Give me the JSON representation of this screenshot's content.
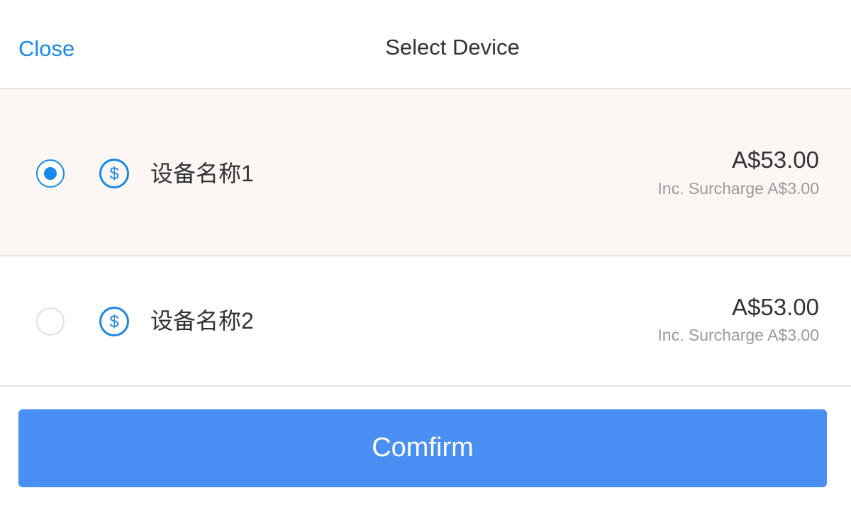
{
  "header": {
    "close_label": "Close",
    "title": "Select Device"
  },
  "devices": [
    {
      "name": "设备名称1",
      "price": "A$53.00",
      "surcharge": "Inc. Surcharge A$3.00",
      "selected": true,
      "icon": "dollar-circle-icon"
    },
    {
      "name": "设备名称2",
      "price": "A$53.00",
      "surcharge": "Inc. Surcharge A$3.00",
      "selected": false,
      "icon": "dollar-circle-icon"
    }
  ],
  "footer": {
    "confirm_label": "Comfirm"
  },
  "colors": {
    "accent": "#1a88e8",
    "button": "#4a8ff4",
    "selected_row_bg": "#fcf7f4",
    "divider": "#e6e6e6"
  }
}
